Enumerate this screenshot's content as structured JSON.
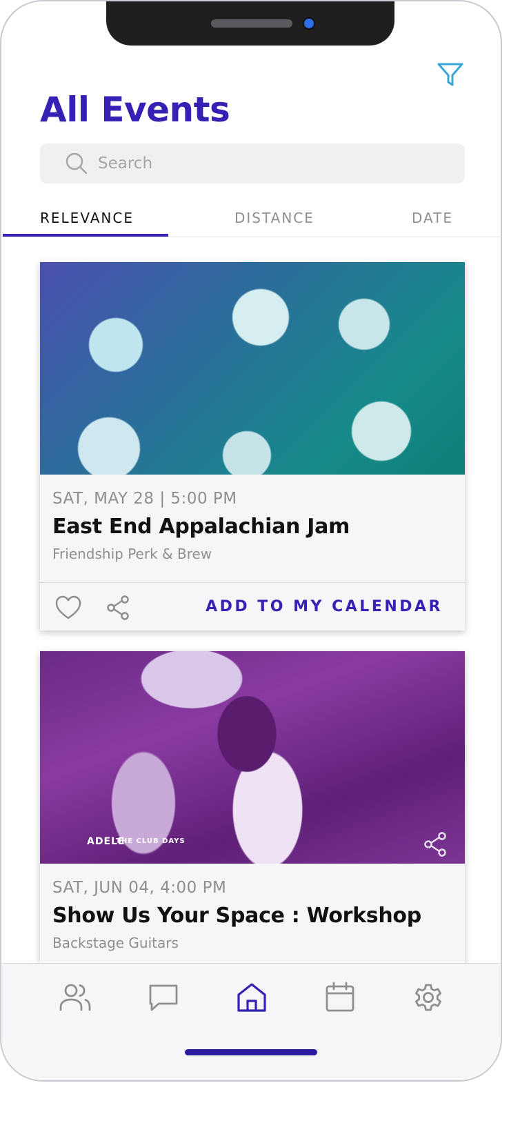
{
  "header": {
    "title": "All Events"
  },
  "search": {
    "placeholder": "Search"
  },
  "tabs": [
    {
      "label": "RELEVANCE",
      "active": true
    },
    {
      "label": "DISTANCE",
      "active": false
    },
    {
      "label": "DATE",
      "active": false
    }
  ],
  "events": [
    {
      "date": "SAT, MAY 28 | 5:00 PM",
      "title": "East End Appalachian Jam",
      "venue": "Friendship Perk & Brew",
      "action_label": "ADD TO MY CALENDAR"
    },
    {
      "date": "SAT, JUN 04, 4:00 PM",
      "title": "Show Us Your Space : Workshop",
      "venue": "Backstage Guitars",
      "image_text": [
        "ADELE",
        "THE CLUB DAYS"
      ]
    }
  ],
  "nav": [
    {
      "icon": "users-icon",
      "active": false
    },
    {
      "icon": "chat-icon",
      "active": false
    },
    {
      "icon": "home-icon",
      "active": true
    },
    {
      "icon": "calendar-icon",
      "active": false
    },
    {
      "icon": "gear-icon",
      "active": false
    }
  ],
  "colors": {
    "accent": "#3522b4",
    "filter": "#3aa6d8",
    "muted": "#8e8e93"
  }
}
